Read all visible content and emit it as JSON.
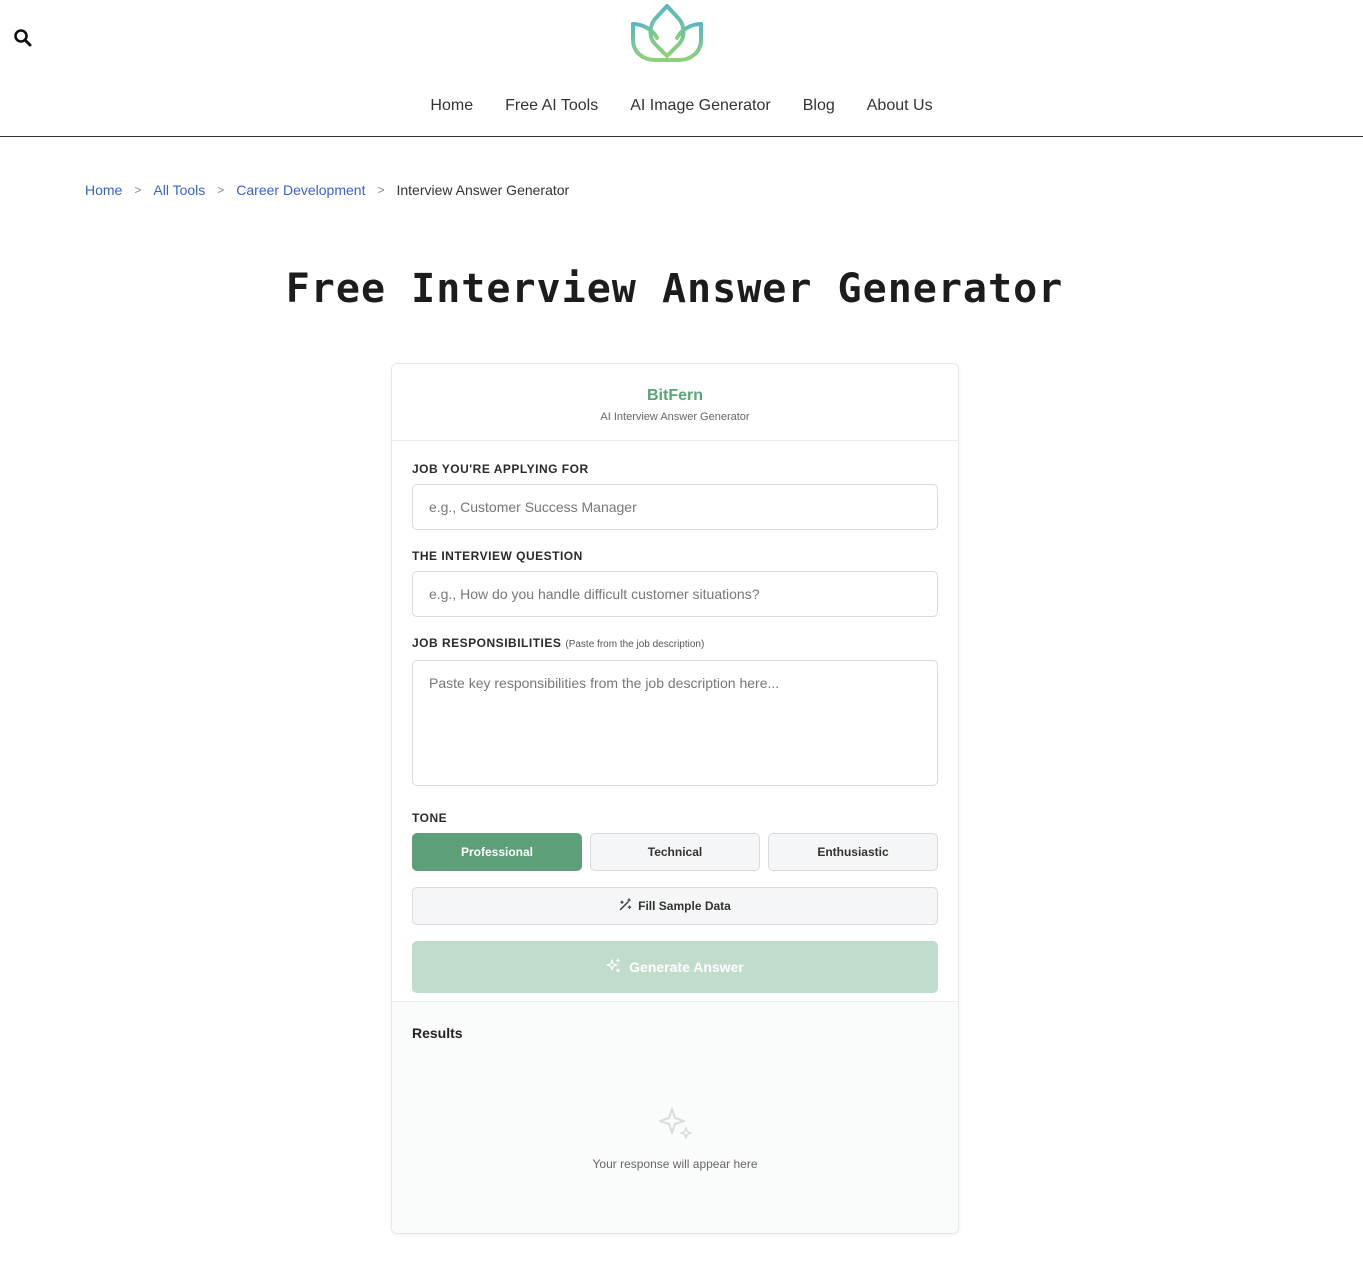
{
  "nav": {
    "items": [
      {
        "label": "Home"
      },
      {
        "label": "Free AI Tools"
      },
      {
        "label": "AI Image Generator"
      },
      {
        "label": "Blog"
      },
      {
        "label": "About Us"
      }
    ]
  },
  "breadcrumb": {
    "items": [
      "Home",
      "All Tools",
      "Career Development"
    ],
    "separator": ">",
    "current": "Interview Answer Generator"
  },
  "page": {
    "title": "Free Interview Answer Generator"
  },
  "card": {
    "brand": "BitFern",
    "subtitle": "AI Interview Answer Generator"
  },
  "form": {
    "job_label": "JOB YOU'RE APPLYING FOR",
    "job_placeholder": "e.g., Customer Success Manager",
    "question_label": "THE INTERVIEW QUESTION",
    "question_placeholder": "e.g., How do you handle difficult customer situations?",
    "resp_label": "JOB RESPONSIBILITIES",
    "resp_hint": "(Paste from the job description)",
    "resp_placeholder": "Paste key responsibilities from the job description here...",
    "tone_label": "TONE",
    "tones": [
      "Professional",
      "Technical",
      "Enthusiastic"
    ],
    "active_tone": "Professional",
    "sample_label": "Fill Sample Data",
    "generate_label": "Generate Answer"
  },
  "results": {
    "title": "Results",
    "empty": "Your response will appear here"
  },
  "colors": {
    "accent": "#5c9f78",
    "accent_disabled": "#c0dccd",
    "link": "#3a62c4"
  },
  "icons": [
    "search-icon",
    "logo-leaf-icon",
    "magic-wand-icon",
    "sparkle-icon"
  ]
}
